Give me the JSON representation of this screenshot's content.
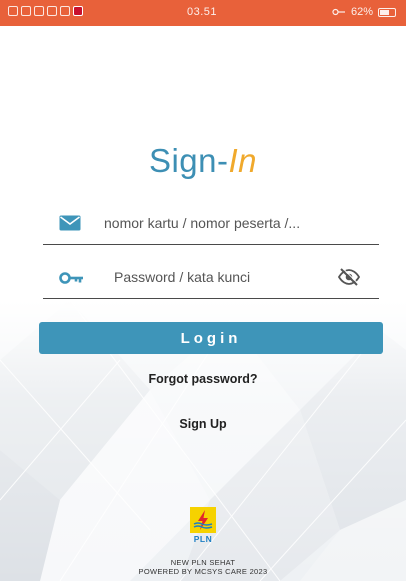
{
  "status_bar": {
    "time": "03.51",
    "battery": "62%"
  },
  "title": {
    "part1": "Sign-",
    "part2": "In"
  },
  "form": {
    "username_placeholder": "nomor kartu / nomor peserta /...",
    "password_placeholder": "Password / kata kunci",
    "login_label": "Login",
    "forgot_label": "Forgot password?",
    "signup_label": "Sign Up"
  },
  "branding": {
    "logo_text": "PLN",
    "footer_line1": "NEW PLN SEHAT",
    "footer_line2": "POWERED BY MCSYS CARE 2023",
    "accent_blue": "#3e95b9",
    "accent_orange": "#f0a92c",
    "logo_yellow": "#f6d200"
  },
  "icons": {
    "username": "mail-icon",
    "password": "key-icon",
    "visibility": "eye-off-icon"
  }
}
